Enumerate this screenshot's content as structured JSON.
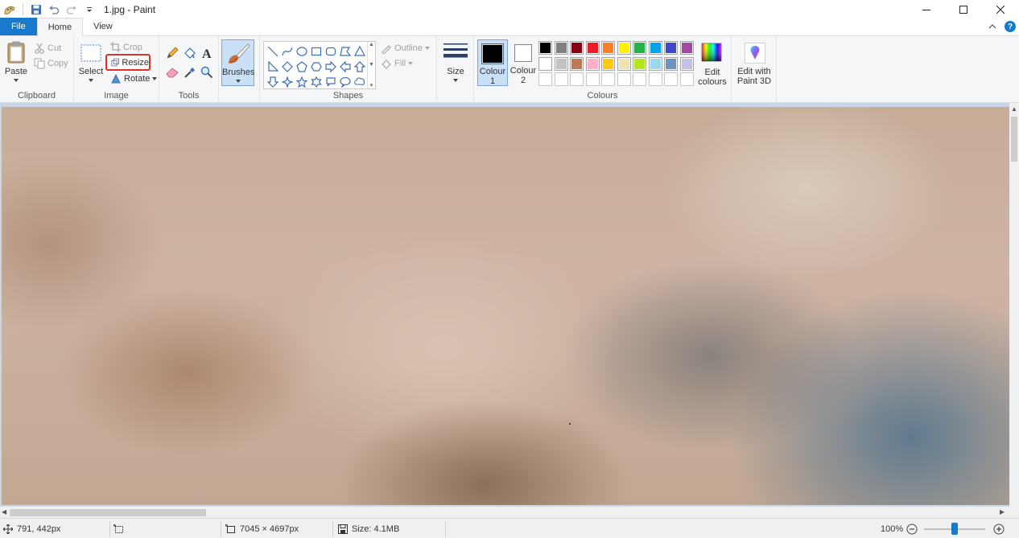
{
  "window": {
    "title": "1.jpg - Paint"
  },
  "tabs": [
    {
      "label": "File"
    },
    {
      "label": "Home"
    },
    {
      "label": "View"
    }
  ],
  "clipboard": {
    "paste_label": "Paste",
    "cut_label": "Cut",
    "copy_label": "Copy",
    "group_label": "Clipboard"
  },
  "image": {
    "select_label": "Select",
    "crop_label": "Crop",
    "resize_label": "Resize",
    "rotate_label": "Rotate",
    "group_label": "Image"
  },
  "tools": {
    "group_label": "Tools",
    "brushes_label": "Brushes"
  },
  "shapes": {
    "outline_label": "Outline",
    "fill_label": "Fill",
    "group_label": "Shapes"
  },
  "size": {
    "label": "Size"
  },
  "colours": {
    "colour1_label": "Colour",
    "colour1_num": "1",
    "colour2_label": "Colour",
    "colour2_num": "2",
    "colour1_value": "#000000",
    "colour2_value": "#ffffff",
    "palette_row1": [
      "#000000",
      "#7f7f7f",
      "#880015",
      "#ed1c24",
      "#ff7f27",
      "#fff200",
      "#22b14c",
      "#00a2e8",
      "#3f48cc",
      "#a349a4"
    ],
    "palette_row2": [
      "#ffffff",
      "#c3c3c3",
      "#b97a57",
      "#ffaec9",
      "#ffc90e",
      "#efe4b0",
      "#b5e61d",
      "#99d9ea",
      "#7092be",
      "#c8bfe7"
    ],
    "edit_label_1": "Edit",
    "edit_label_2": "colours",
    "paint3d_label_1": "Edit with",
    "paint3d_label_2": "Paint 3D",
    "group_label": "Colours"
  },
  "status": {
    "cursor_pos": "791, 442px",
    "image_dims": "7045 × 4697px",
    "file_size": "Size: 4.1MB",
    "zoom": "100%",
    "zoom_level": 0.5
  }
}
